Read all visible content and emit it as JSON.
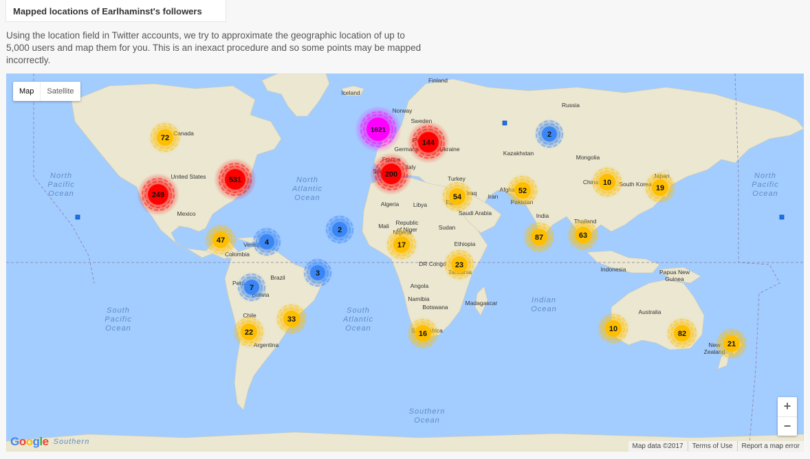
{
  "header": {
    "title": "Mapped locations of Earlhaminst's followers",
    "description": "Using the location field in Twitter accounts, we try to approximate the geographic location of up to 5,000 users and map them for you. This is an inexact procedure and so some points may be mapped incorrectly."
  },
  "map": {
    "type_controls": [
      "Map",
      "Satellite"
    ],
    "zoom_in": "+",
    "zoom_out": "−",
    "logo": "Google",
    "footer": [
      "Map data ©2017",
      "Terms of Use",
      "Report a map error"
    ],
    "colors": {
      "water": "#a3ccff",
      "land": "#ece8d2",
      "cluster_small": "#3b86f5",
      "cluster_medium": "#ffbf00",
      "cluster_large": "#ff0000",
      "cluster_huge": "#ff00ff"
    },
    "ocean_labels": [
      "North Pacific Ocean",
      "North Atlantic Ocean",
      "South Pacific Ocean",
      "South Atlantic Ocean",
      "Indian Ocean",
      "Southern Ocean",
      "North Pacific Ocean"
    ],
    "place_labels": [
      "Canada",
      "United States",
      "Mexico",
      "Venezuela",
      "Colombia",
      "Peru",
      "Brazil",
      "Bolivia",
      "Chile",
      "Argentina",
      "Iceland",
      "Finland",
      "Norway",
      "Sweden",
      "Russia",
      "Germany",
      "Poland",
      "Ukraine",
      "France",
      "Spain",
      "Italy",
      "Turkey",
      "Iraq",
      "Iran",
      "Afghanistan",
      "Pakistan",
      "Kazakhstan",
      "Mongolia",
      "China",
      "South Korea",
      "Japan",
      "India",
      "Thailand",
      "Indonesia",
      "Papua New Guinea",
      "Australia",
      "New Zealand",
      "Algeria",
      "Libya",
      "Egypt",
      "Mali",
      "Niger",
      "Sudan",
      "Ethiopia",
      "Saudi Arabia",
      "Nigeria",
      "DR Congo",
      "Tanzania",
      "Angola",
      "Namibia",
      "Botswana",
      "Madagascar",
      "South Africa",
      "Southern"
    ],
    "clusters": [
      {
        "count": "1621",
        "tier": "huge"
      },
      {
        "count": "144",
        "tier": "large"
      },
      {
        "count": "200",
        "tier": "large"
      },
      {
        "count": "531",
        "tier": "large"
      },
      {
        "count": "249",
        "tier": "large"
      },
      {
        "count": "72",
        "tier": "medium"
      },
      {
        "count": "2",
        "tier": "small"
      },
      {
        "count": "10",
        "tier": "medium"
      },
      {
        "count": "19",
        "tier": "medium"
      },
      {
        "count": "52",
        "tier": "medium"
      },
      {
        "count": "54",
        "tier": "medium"
      },
      {
        "count": "87",
        "tier": "medium"
      },
      {
        "count": "63",
        "tier": "medium"
      },
      {
        "count": "47",
        "tier": "medium"
      },
      {
        "count": "4",
        "tier": "small"
      },
      {
        "count": "2",
        "tier": "small"
      },
      {
        "count": "17",
        "tier": "medium"
      },
      {
        "count": "23",
        "tier": "medium"
      },
      {
        "count": "3",
        "tier": "small"
      },
      {
        "count": "7",
        "tier": "small"
      },
      {
        "count": "33",
        "tier": "medium"
      },
      {
        "count": "22",
        "tier": "medium"
      },
      {
        "count": "16",
        "tier": "medium"
      },
      {
        "count": "10",
        "tier": "medium"
      },
      {
        "count": "82",
        "tier": "medium"
      },
      {
        "count": "21",
        "tier": "medium"
      }
    ]
  }
}
